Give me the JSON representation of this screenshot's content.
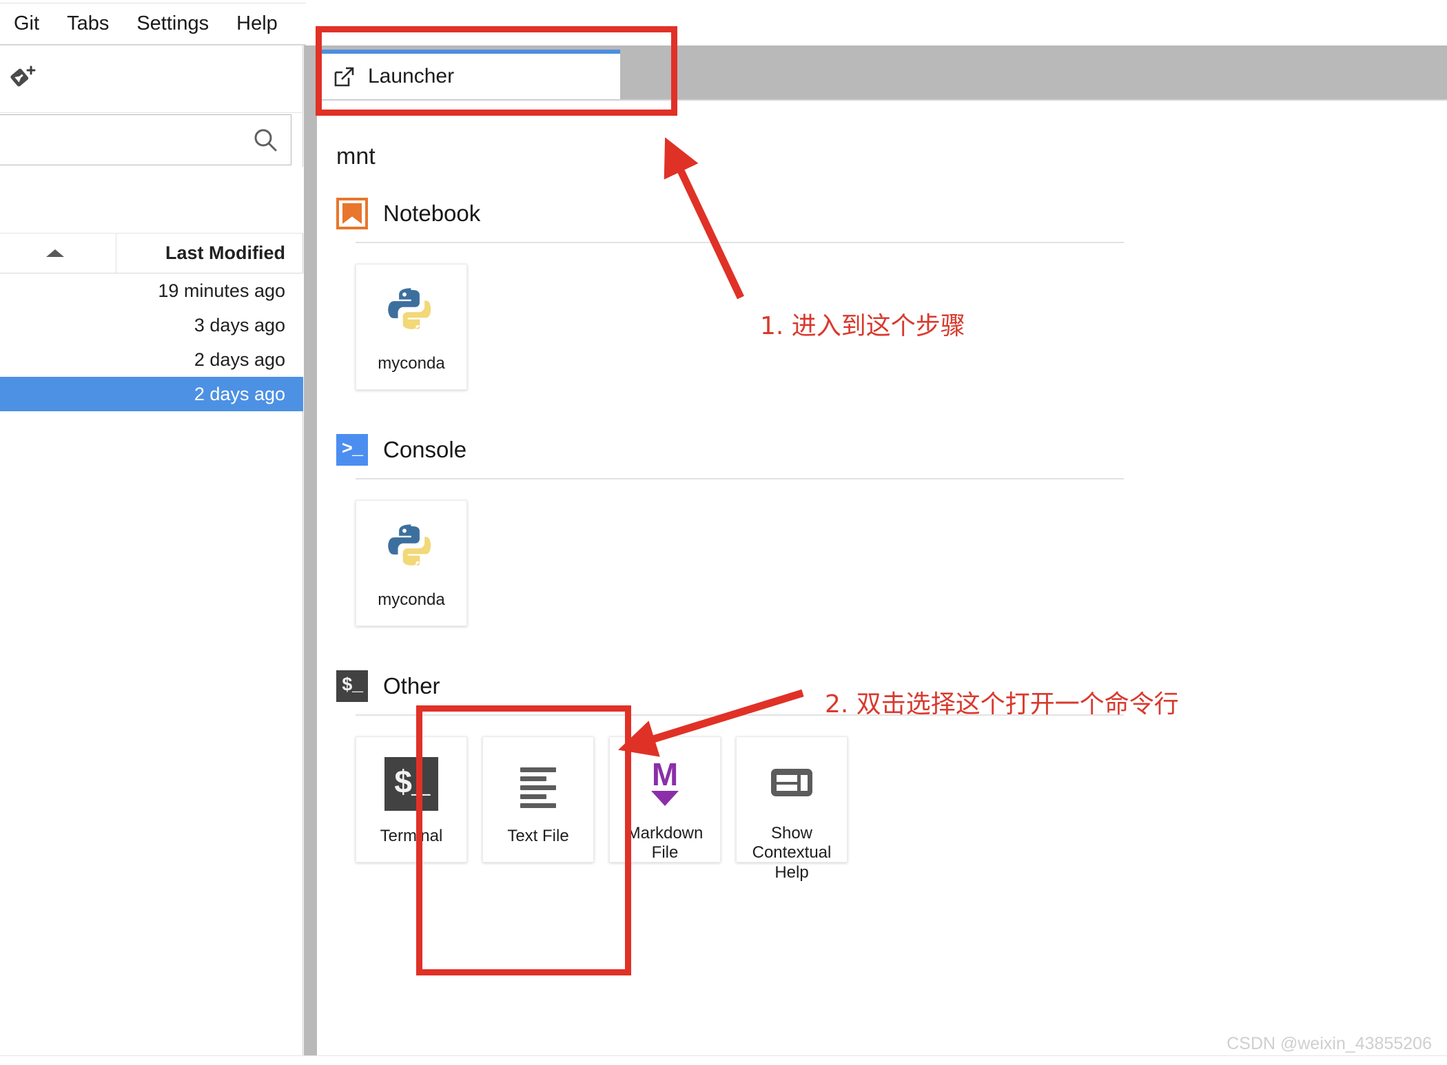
{
  "menubar": {
    "items": [
      {
        "label": "Git",
        "name": "menu-git"
      },
      {
        "label": "Tabs",
        "name": "menu-tabs"
      },
      {
        "label": "Settings",
        "name": "menu-settings"
      },
      {
        "label": "Help",
        "name": "menu-help"
      }
    ]
  },
  "sidebar": {
    "git_icon": "git-new-branch-icon",
    "search": {
      "value": "",
      "placeholder": "",
      "icon": "search-icon"
    },
    "file_list": {
      "columns": [
        {
          "label": "",
          "sort": "ascending",
          "icon": "sort-ascending-caret-icon"
        },
        {
          "label": "Last Modified"
        }
      ],
      "rows": [
        {
          "last_modified": "19 minutes ago",
          "selected": false
        },
        {
          "last_modified": "3 days ago",
          "selected": false
        },
        {
          "last_modified": "2 days ago",
          "selected": false
        },
        {
          "last_modified": "2 days ago",
          "selected": true
        }
      ]
    }
  },
  "dock": {
    "tabs": [
      {
        "label": "Launcher",
        "icon": "launcher-external-link-icon",
        "active": true
      }
    ]
  },
  "launcher": {
    "cwd": "mnt",
    "sections": [
      {
        "title": "Notebook",
        "icon": "jupyter-notebook-icon",
        "cards": [
          {
            "label": "myconda",
            "icon": "python-logo-icon"
          }
        ]
      },
      {
        "title": "Console",
        "icon": "console-prompt-icon",
        "cards": [
          {
            "label": "myconda",
            "icon": "python-logo-icon"
          }
        ]
      },
      {
        "title": "Other",
        "icon": "terminal-prompt-icon",
        "cards": [
          {
            "label": "Terminal",
            "icon": "terminal-icon"
          },
          {
            "label": "Text File",
            "icon": "text-file-icon"
          },
          {
            "label": "Markdown File",
            "icon": "markdown-icon"
          },
          {
            "label": "Show Contextual Help",
            "icon": "contextual-help-icon"
          }
        ]
      }
    ]
  },
  "annotations": [
    {
      "text": "1. 进入到这个步骤",
      "name": "annotation-step-1"
    },
    {
      "text": "2. 双击选择这个打开一个命令行",
      "name": "annotation-step-2"
    }
  ],
  "watermark": {
    "text": "CSDN @weixin_43855206"
  },
  "colors": {
    "accent_blue": "#4c91e3",
    "tab_active_border": "#4b8fe0",
    "annotation_red": "#e03127",
    "notebook_orange": "#e8762c",
    "console_blue": "#4c8ef0",
    "terminal_dark": "#424242",
    "markdown_purple": "#8b2fa8",
    "dock_gutter_gray": "#b9b9b9"
  }
}
